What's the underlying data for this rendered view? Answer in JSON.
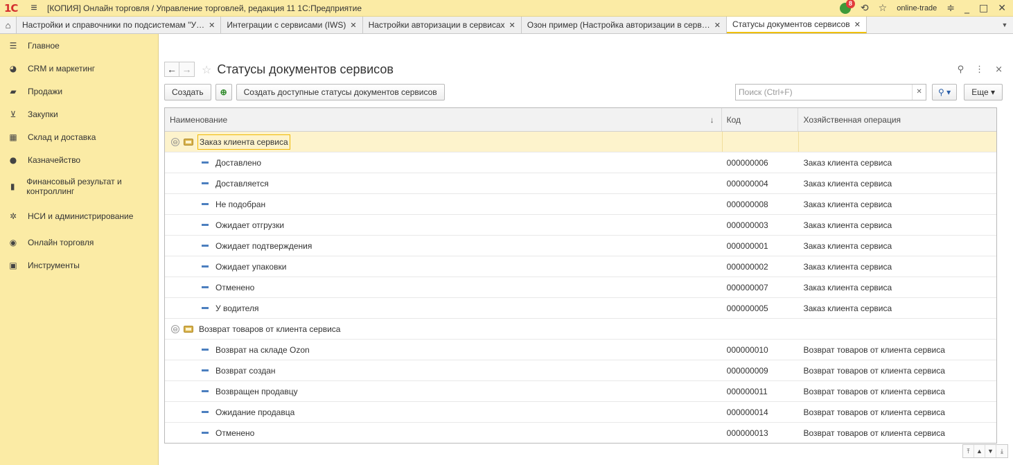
{
  "app": {
    "logo": "1С",
    "title": "[КОПИЯ] Онлайн торговля / Управление торговлей, редакция 11 1С:Предприятие",
    "user": "online-trade",
    "notification_count": "8",
    "accent_color": "#fbeba5"
  },
  "tabs": [
    {
      "label": "Настройки и справочники по подсистемам \"У…"
    },
    {
      "label": "Интеграции с сервисами (IWS)"
    },
    {
      "label": "Настройки авторизации в сервисах"
    },
    {
      "label": "Озон пример (Настройка авторизации в серв…"
    },
    {
      "label": "Статусы документов сервисов"
    }
  ],
  "sidebar": {
    "items": [
      {
        "label": "Главное",
        "icon": "menu-lines-icon"
      },
      {
        "label": "CRM и маркетинг",
        "icon": "pie-chart-icon"
      },
      {
        "label": "Продажи",
        "icon": "shopping-bag-icon"
      },
      {
        "label": "Закупки",
        "icon": "cart-icon"
      },
      {
        "label": "Склад и доставка",
        "icon": "warehouse-icon"
      },
      {
        "label": "Казначейство",
        "icon": "ruble-coin-icon"
      },
      {
        "label": "Финансовый результат и контроллинг",
        "icon": "bar-chart-icon"
      },
      {
        "label": "НСИ и администрирование",
        "icon": "gear-icon"
      },
      {
        "label": "Онлайн торговля",
        "icon": "globe-icon"
      },
      {
        "label": "Инструменты",
        "icon": "calculator-icon"
      }
    ]
  },
  "form": {
    "title": "Статусы документов сервисов",
    "create_label": "Создать",
    "create_available_label": "Создать доступные статусы документов сервисов",
    "search_placeholder": "Поиск (Ctrl+F)",
    "more_label": "Еще"
  },
  "table": {
    "columns": [
      "Наименование",
      "Код",
      "Хозяйственная операция"
    ],
    "groups": [
      {
        "label": "Заказ клиента сервиса",
        "selected": true,
        "items": [
          {
            "name": "Доставлено",
            "code": "000000006",
            "operation": "Заказ клиента сервиса"
          },
          {
            "name": "Доставляется",
            "code": "000000004",
            "operation": "Заказ клиента сервиса"
          },
          {
            "name": "Не подобран",
            "code": "000000008",
            "operation": "Заказ клиента сервиса"
          },
          {
            "name": "Ожидает отгрузки",
            "code": "000000003",
            "operation": "Заказ клиента сервиса"
          },
          {
            "name": "Ожидает подтверждения",
            "code": "000000001",
            "operation": "Заказ клиента сервиса"
          },
          {
            "name": "Ожидает упаковки",
            "code": "000000002",
            "operation": "Заказ клиента сервиса"
          },
          {
            "name": "Отменено",
            "code": "000000007",
            "operation": "Заказ клиента сервиса"
          },
          {
            "name": "У водителя",
            "code": "000000005",
            "operation": "Заказ клиента сервиса"
          }
        ]
      },
      {
        "label": "Возврат товаров от клиента сервиса",
        "selected": false,
        "items": [
          {
            "name": "Возврат на складе Ozon",
            "code": "000000010",
            "operation": "Возврат товаров от клиента сервиса"
          },
          {
            "name": "Возврат создан",
            "code": "000000009",
            "operation": "Возврат товаров от клиента сервиса"
          },
          {
            "name": "Возвращен продавцу",
            "code": "000000011",
            "operation": "Возврат товаров от клиента сервиса"
          },
          {
            "name": "Ожидание продавца",
            "code": "000000014",
            "operation": "Возврат товаров от клиента сервиса"
          },
          {
            "name": "Отменено",
            "code": "000000013",
            "operation": "Возврат товаров от клиента сервиса"
          }
        ]
      }
    ]
  }
}
